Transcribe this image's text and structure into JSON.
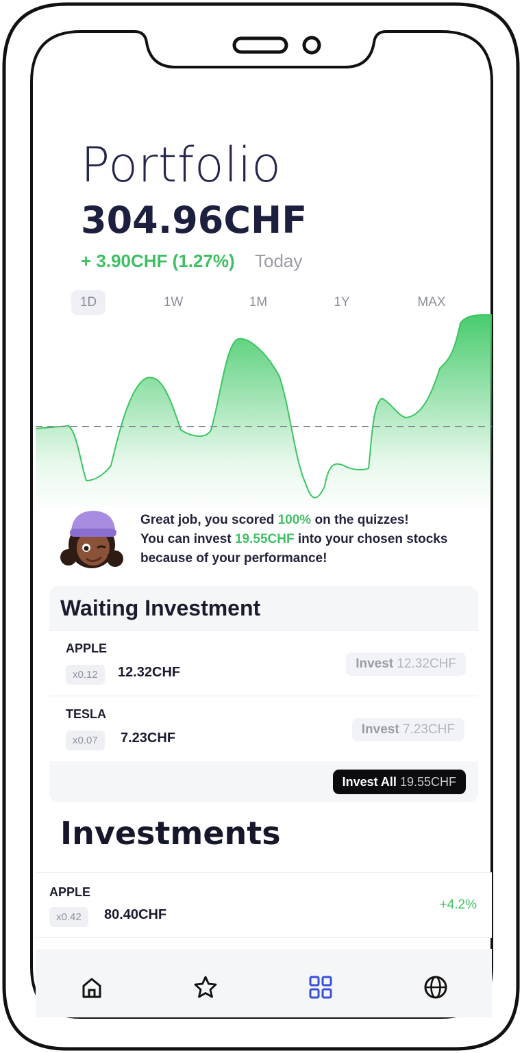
{
  "portfolio": {
    "title": "Portfolio",
    "value": "304.96CHF",
    "change": "+ 3.90CHF (1.27%)",
    "period_label": "Today"
  },
  "ranges": [
    "1D",
    "1W",
    "1M",
    "1Y",
    "MAX"
  ],
  "selected_range": "1D",
  "coach": {
    "line1_pre": "Great job, you scored ",
    "line1_hl": "100%",
    "line1_post": " on the quizzes!",
    "line2_pre": "You can invest ",
    "line2_hl": "19.55CHF",
    "line2_post": " into your chosen stocks",
    "line3": "because of your performance!"
  },
  "waiting": {
    "title": "Waiting Investment",
    "items": [
      {
        "name": "APPLE",
        "qty": "x0.12",
        "amount": "12.32CHF",
        "invest_label": "Invest",
        "invest_amount": "12.32CHF"
      },
      {
        "name": "TESLA",
        "qty": "x0.07",
        "amount": "7.23CHF",
        "invest_label": "Invest",
        "invest_amount": "7.23CHF"
      }
    ],
    "invest_all_label": "Invest All",
    "invest_all_amount": "19.55CHF"
  },
  "investments": {
    "title": "Investments",
    "items": [
      {
        "name": "APPLE",
        "qty": "x0.42",
        "amount": "80.40CHF",
        "change": "+4.2%"
      }
    ]
  },
  "tabs": [
    "home-icon",
    "star-icon",
    "grid-icon",
    "globe-icon"
  ],
  "colors": {
    "accent_green": "#3fbf63",
    "active_tab": "#3b4fd8",
    "text_dark": "#1c1f3d"
  }
}
